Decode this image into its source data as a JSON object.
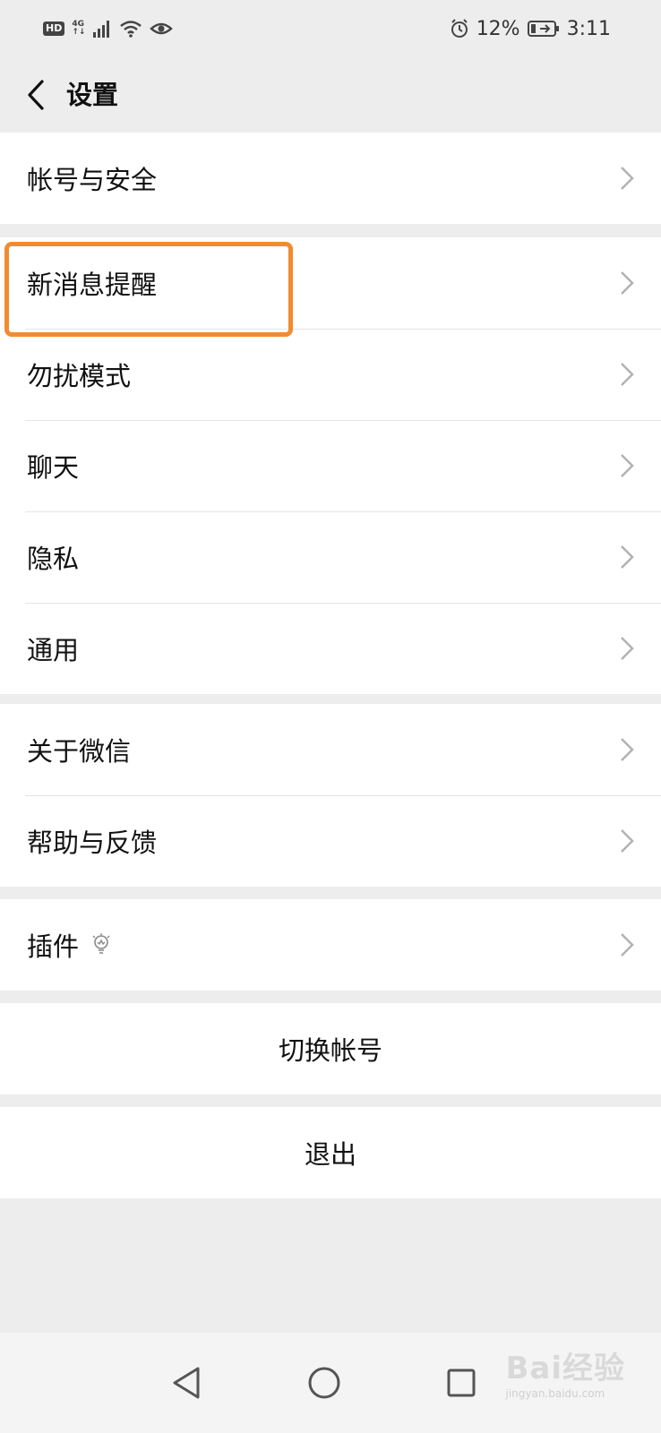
{
  "status_bar": {
    "hd": "HD",
    "network": "4G",
    "battery": "12%",
    "time": "3:11",
    "icons": [
      "signal-icon",
      "wifi-icon",
      "eye-icon",
      "alarm-icon",
      "battery-icon"
    ]
  },
  "header": {
    "back_icon": "chevron-left-icon",
    "title": "设置"
  },
  "groups": [
    {
      "items": [
        {
          "label": "帐号与安全"
        }
      ]
    },
    {
      "items": [
        {
          "label": "新消息提醒",
          "highlighted": true
        },
        {
          "label": "勿扰模式"
        },
        {
          "label": "聊天"
        },
        {
          "label": "隐私"
        },
        {
          "label": "通用"
        }
      ]
    },
    {
      "items": [
        {
          "label": "关于微信"
        },
        {
          "label": "帮助与反馈"
        }
      ]
    },
    {
      "items": [
        {
          "label": "插件",
          "icon": "lightbulb-icon"
        }
      ]
    }
  ],
  "actions": {
    "switch_account": "切换帐号",
    "logout": "退出"
  },
  "nav_bar": {
    "icons": [
      "back-triangle-icon",
      "home-circle-icon",
      "recents-square-icon"
    ]
  },
  "watermark": {
    "brand": "Bai经验",
    "url": "jingyan.baidu.com"
  },
  "colors": {
    "background": "#ededed",
    "highlight": "#f28b30",
    "chevron": "#b2b2b2"
  }
}
